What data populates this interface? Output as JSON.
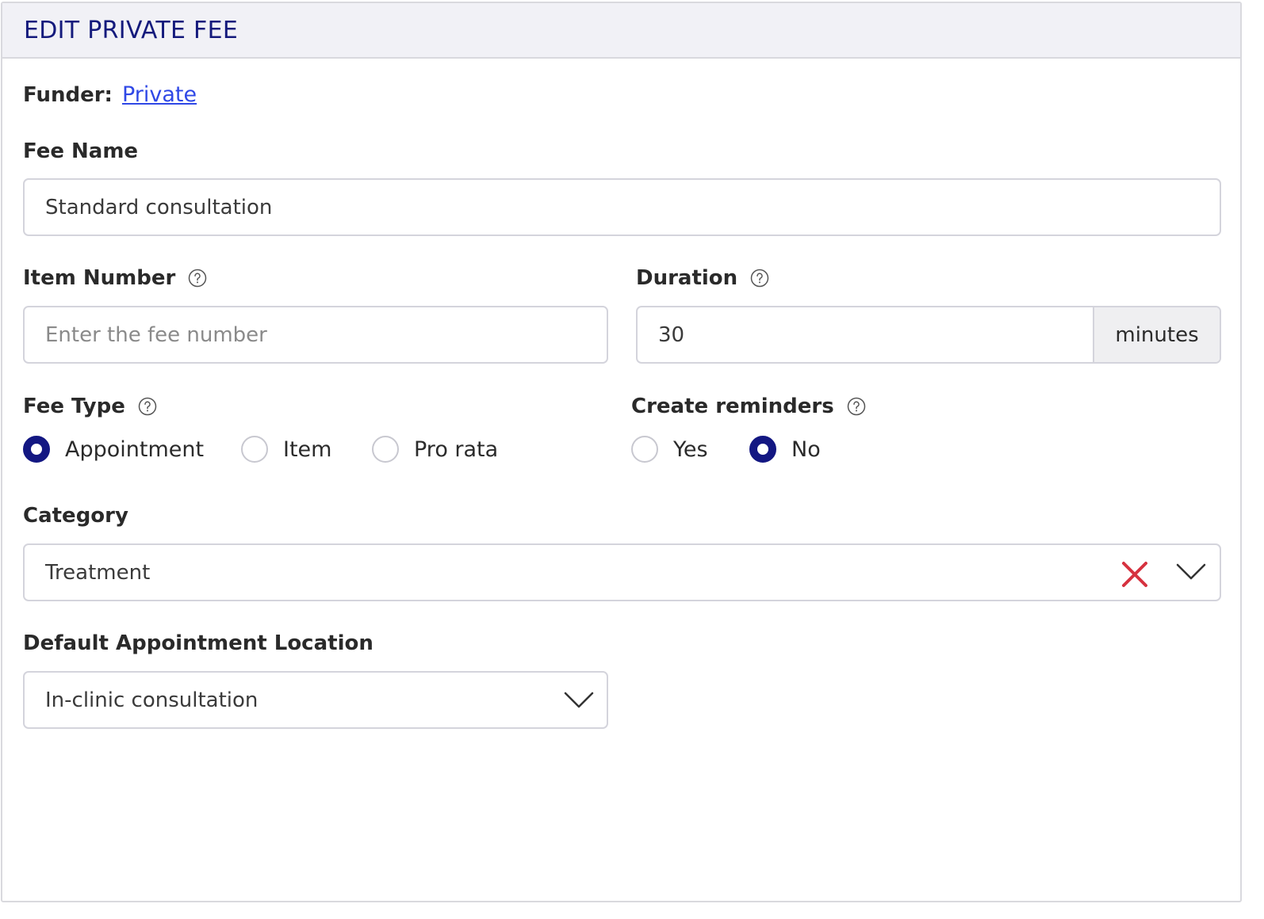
{
  "panel": {
    "title": "EDIT PRIVATE FEE"
  },
  "funder": {
    "label": "Funder:",
    "value": "Private"
  },
  "fee_name": {
    "label": "Fee Name",
    "value": "Standard consultation"
  },
  "item_number": {
    "label": "Item Number",
    "value": "",
    "placeholder": "Enter the fee number"
  },
  "duration": {
    "label": "Duration",
    "value": "30",
    "unit": "minutes"
  },
  "fee_type": {
    "label": "Fee Type",
    "options": [
      {
        "label": "Appointment",
        "checked": true
      },
      {
        "label": "Item",
        "checked": false
      },
      {
        "label": "Pro rata",
        "checked": false
      }
    ]
  },
  "create_reminders": {
    "label": "Create reminders",
    "options": [
      {
        "label": "Yes",
        "checked": false
      },
      {
        "label": "No",
        "checked": true
      }
    ]
  },
  "category": {
    "label": "Category",
    "value": "Treatment"
  },
  "default_location": {
    "label": "Default Appointment Location",
    "value": "In-clinic consultation"
  },
  "colors": {
    "accent": "#131782",
    "link": "#2f48e6",
    "clear": "#d6323f"
  }
}
